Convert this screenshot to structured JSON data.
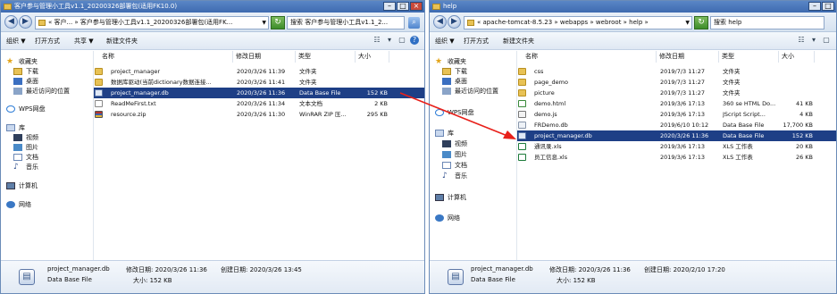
{
  "left": {
    "title": "客户参与管理小工具v1.1_20200326部署包(适用FK10.0)",
    "address": "« 客户... » 客户参与管理小工具v1.1_20200326部署包(适用FK...",
    "search_placeholder": "搜索 客户参与管理小工具v1.1_2...",
    "toolbar": {
      "organize": "组织 ▼",
      "open_with": "打开方式",
      "share": "共享 ▼",
      "new_folder": "新建文件夹"
    },
    "nav": {
      "favorites": "收藏夹",
      "downloads": "下载",
      "desktop": "桌面",
      "recent": "最近访问的位置",
      "wps": "WPS网盘",
      "libraries": "库",
      "videos": "视频",
      "pictures": "图片",
      "documents": "文档",
      "music": "音乐",
      "computer": "计算机",
      "network": "网络"
    },
    "columns": {
      "name": "名称",
      "date": "修改日期",
      "type": "类型",
      "size": "大小"
    },
    "files": [
      {
        "icon": "folder",
        "name": "project_manager",
        "date": "2020/3/26 11:39",
        "type": "文件夹",
        "size": "",
        "selected": false
      },
      {
        "icon": "folder",
        "name": "数据库驱动(当前dictionary数据连接...",
        "date": "2020/3/26 11:41",
        "type": "文件夹",
        "size": "",
        "selected": false
      },
      {
        "icon": "db",
        "name": "project_manager.db",
        "date": "2020/3/26 11:36",
        "type": "Data Base File",
        "size": "152 KB",
        "selected": true
      },
      {
        "icon": "txt",
        "name": "ReadMeFirst.txt",
        "date": "2020/3/26 11:34",
        "type": "文本文档",
        "size": "2 KB",
        "selected": false
      },
      {
        "icon": "zip",
        "name": "resource.zip",
        "date": "2020/3/26 11:30",
        "type": "WinRAR ZIP 压...",
        "size": "295 KB",
        "selected": false
      }
    ],
    "details": {
      "filename": "project_manager.db",
      "modified": "修改日期: 2020/3/26 11:36",
      "created": "创建日期: 2020/3/26 13:45",
      "type": "Data Base File",
      "size": "大小: 152 KB"
    }
  },
  "right": {
    "title": "help",
    "address": "« apache-tomcat-8.5.23 » webapps » webroot » help »",
    "search_placeholder": "搜索 help",
    "toolbar": {
      "organize": "组织 ▼",
      "open_with": "打开方式",
      "new_folder": "新建文件夹"
    },
    "nav": {
      "favorites": "收藏夹",
      "downloads": "下载",
      "desktop": "桌面",
      "recent": "最近访问的位置",
      "wps": "WPS网盘",
      "libraries": "库",
      "videos": "视频",
      "pictures": "图片",
      "documents": "文档",
      "music": "音乐",
      "computer": "计算机",
      "network": "网络"
    },
    "columns": {
      "name": "名称",
      "date": "修改日期",
      "type": "类型",
      "size": "大小"
    },
    "files": [
      {
        "icon": "folder",
        "name": "css",
        "date": "2019/7/3 11:27",
        "type": "文件夹",
        "size": "",
        "selected": false
      },
      {
        "icon": "folder",
        "name": "page_demo",
        "date": "2019/7/3 11:27",
        "type": "文件夹",
        "size": "",
        "selected": false
      },
      {
        "icon": "folder",
        "name": "picture",
        "date": "2019/7/3 11:27",
        "type": "文件夹",
        "size": "",
        "selected": false
      },
      {
        "icon": "html",
        "name": "demo.html",
        "date": "2019/3/6 17:13",
        "type": "360 se HTML Do...",
        "size": "41 KB",
        "selected": false
      },
      {
        "icon": "js",
        "name": "demo.js",
        "date": "2019/3/6 17:13",
        "type": "JScript Script...",
        "size": "4 KB",
        "selected": false
      },
      {
        "icon": "gen",
        "name": "FRDemo.db",
        "date": "2019/6/10 10:12",
        "type": "Data Base File",
        "size": "17,700 KB",
        "selected": false
      },
      {
        "icon": "db",
        "name": "project_manager.db",
        "date": "2020/3/26 11:36",
        "type": "Data Base File",
        "size": "152 KB",
        "selected": true
      },
      {
        "icon": "xls",
        "name": "通讯录.xls",
        "date": "2019/3/6 17:13",
        "type": "XLS 工作表",
        "size": "20 KB",
        "selected": false
      },
      {
        "icon": "xls",
        "name": "员工信息.xls",
        "date": "2019/3/6 17:13",
        "type": "XLS 工作表",
        "size": "26 KB",
        "selected": false
      }
    ],
    "details": {
      "filename": "project_manager.db",
      "modified": "修改日期: 2020/3/26 11:36",
      "created": "创建日期: 2020/2/10 17:20",
      "type": "Data Base File",
      "size": "大小: 152 KB"
    }
  },
  "colors": {
    "selection": "#1e3f86",
    "arrow": "#e8201a",
    "titlebar": "#3e6bb0"
  }
}
